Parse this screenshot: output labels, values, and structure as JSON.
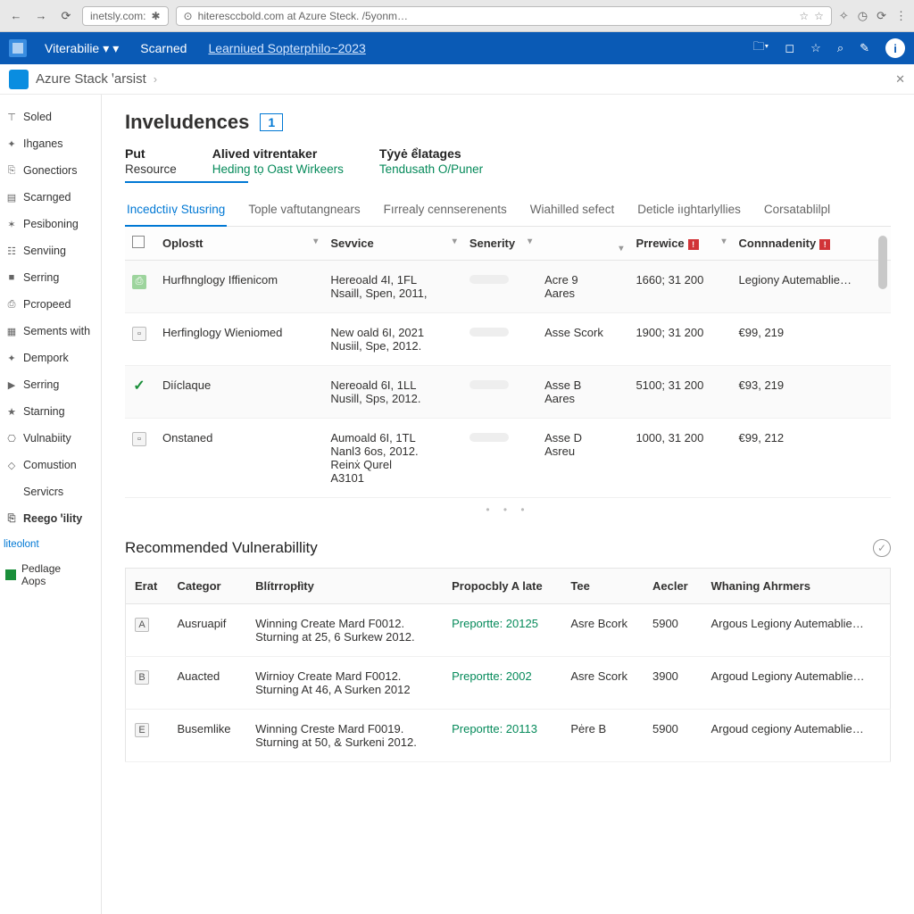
{
  "browser": {
    "tab1": "inetsly.com:",
    "tab2": "hiteresccbold.com at Azure Steck. /5yonm…",
    "chrome_icons": [
      "⟳",
      "◆",
      "★",
      "⌚",
      "⋮"
    ]
  },
  "bluebar": {
    "t1": "Viterabilie",
    "t2": "Scarned",
    "t3": "Learniued Sopterphilo~2023"
  },
  "crumb": "Azure Stack ꞌarsist",
  "sidebar": [
    {
      "icon": "⊤",
      "label": "Soled"
    },
    {
      "icon": "✦",
      "label": "Ihganes"
    },
    {
      "icon": "⎘",
      "label": "Gonectiors"
    },
    {
      "icon": "▤",
      "label": "Scarnged"
    },
    {
      "icon": "✶",
      "label": "Pesiboning"
    },
    {
      "icon": "☷",
      "label": "Senviing"
    },
    {
      "icon": "■",
      "label": "Serring"
    },
    {
      "icon": "⎙",
      "label": "Pcropeed"
    },
    {
      "icon": "▦",
      "label": "Sements with"
    },
    {
      "icon": "✦",
      "label": "Dempork"
    },
    {
      "icon": "▶",
      "label": "Serring"
    },
    {
      "icon": "★",
      "label": "Starning"
    },
    {
      "icon": "⎔",
      "label": "Vulnabiity"
    },
    {
      "icon": "◇",
      "label": "Comustion"
    },
    {
      "icon": "",
      "label": "Servicrs"
    }
  ],
  "side_bold": "Reego ꞌility",
  "side_sub": "liteolont",
  "side_pkg": "Pedlage\nAops",
  "page_title": "Inveludences",
  "title_count": "1",
  "filters": [
    {
      "label": "Put",
      "value": "Resource"
    },
    {
      "label": "Alived vitrentaker",
      "value": "Heding tọ Oast Wirkeers"
    },
    {
      "label": "Tẏyė ểlatages",
      "value": "Tendusath O/Puner"
    }
  ],
  "tabs": [
    "Incedctiıṿ Stusring",
    "Tople vaftutangnears",
    "Fırrealy cennserenents",
    "Wiahilled sefect",
    "Deticle iıghtarlyllies",
    "Corsatablilpl"
  ],
  "table": {
    "headers": [
      "",
      "Oplostt",
      "Sevvice",
      "Senerity",
      "",
      "Prrewice",
      "Connnadenity"
    ],
    "rows": [
      {
        "icon": "g",
        "name": "Hurfhnglogy Iffienicom",
        "service": "Hereoald 4I, 1FL\nNsaill, Spen, 2011,",
        "sev": "",
        "asset": "Acre 9\nAares",
        "price": "1660; 31 200",
        "conf": "Legiony Autemablie…"
      },
      {
        "icon": "d",
        "name": "Herfinglogy Wieniomed",
        "service": "New oald 6I, 2021\nNusiil, Spe, 2012.",
        "sev": "",
        "asset": "Asse Scork",
        "price": "1900; 31 200",
        "conf": "€99, 219"
      },
      {
        "icon": "c",
        "name": "Diíclaque",
        "service": "Nereoald 6I, 1LL\nNusill, Sps, 2012.",
        "sev": "",
        "asset": "Asse B\nAares",
        "price": "5100; 31 200",
        "conf": "€93, 219"
      },
      {
        "icon": "d",
        "name": "Onstaned",
        "service": "Aumoald 6I, 1TL\nNanl3 6os, 2012.\nReinẋ Qurel\nA3101",
        "sev": "",
        "asset": "Asse D\nAsreu",
        "price": "1000, 31 200",
        "conf": "€99, 212"
      }
    ]
  },
  "section2_title": "Recommended Vulnerabillity",
  "table2": {
    "headers": [
      "Erat",
      "Categor",
      "Blítrropłìty",
      "Propocbly A late",
      "Tee",
      "Aecler",
      "Whaning Ahrmers"
    ],
    "rows": [
      {
        "e": "A",
        "cat": "Ausruapif",
        "bit": "Winning Create Mard F0012.\nSturning at 25, 6 Surkew 2012.",
        "pro": "Preportte: 20125",
        "tee": "Asre Bcork",
        "ae": "5900",
        "wh": "Argous Legiony Autemablie…"
      },
      {
        "e": "B",
        "cat": "Auacted",
        "bit": "Wirnioy Create Mard F0012.\nSturning At 46, A Surken 2012",
        "pro": "Preportte: 2002",
        "tee": "Asre Scork",
        "ae": "3900",
        "wh": "Argoud Legiony Autemablie…"
      },
      {
        "e": "E",
        "cat": "Busemlike",
        "bit": "Winning Creste Mard F0019.\nSturning at 50, & Surkeni 2012.",
        "pro": "Preportte: 20113",
        "tee": "Pėre B",
        "ae": "5900",
        "wh": "Argoud cegiony Autemablie…"
      }
    ]
  }
}
